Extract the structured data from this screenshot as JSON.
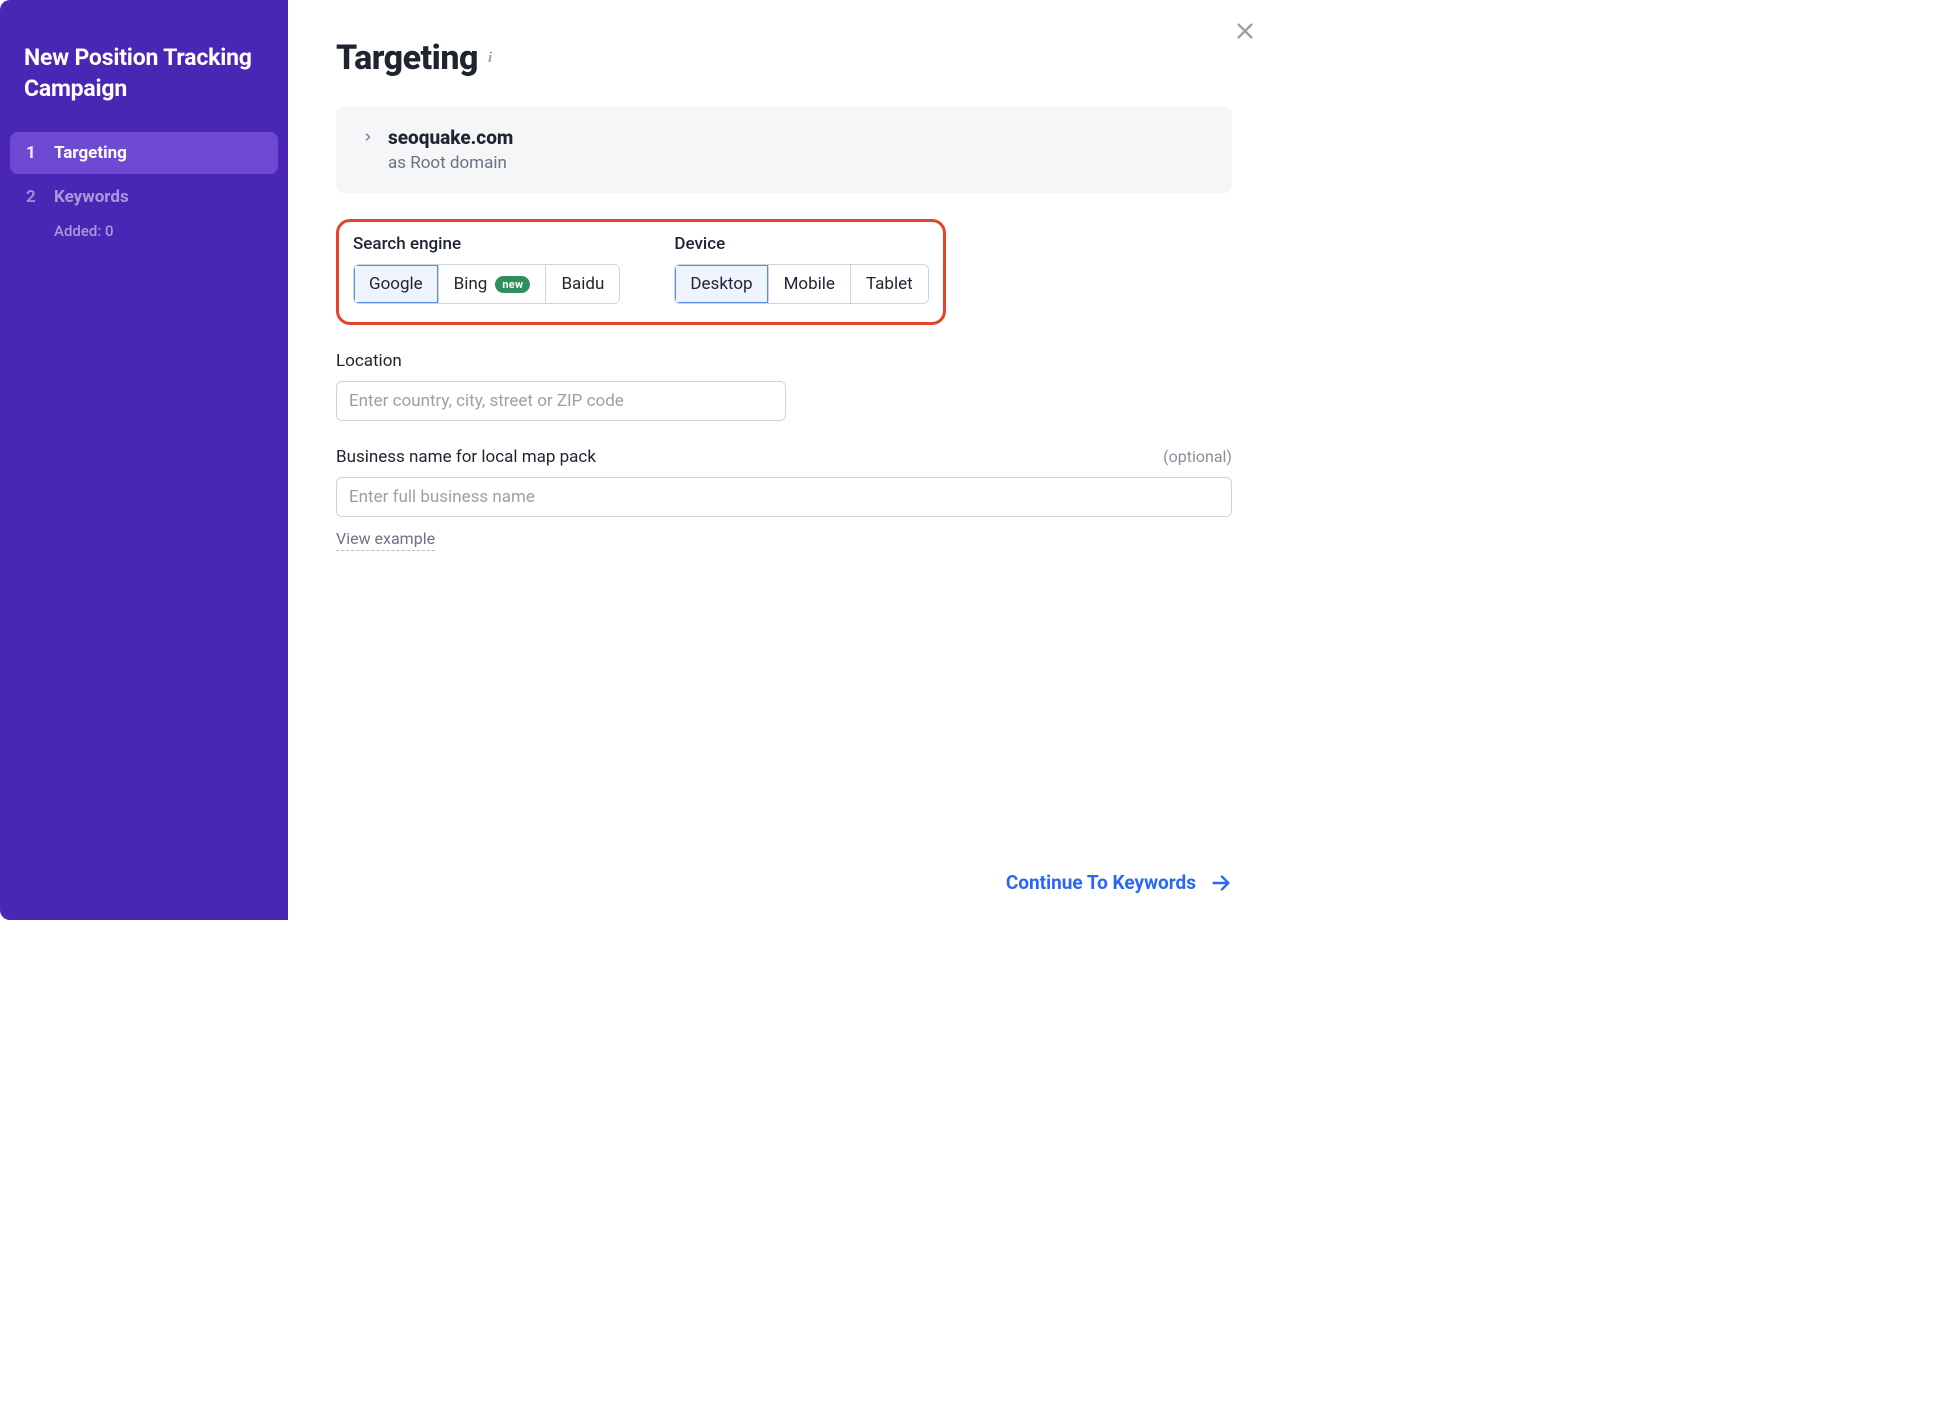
{
  "sidebar": {
    "title": "New Position Tracking Campaign",
    "items": [
      {
        "num": "1",
        "label": "Targeting",
        "active": true
      },
      {
        "num": "2",
        "label": "Keywords",
        "active": false
      }
    ],
    "added_label": "Added: 0"
  },
  "page": {
    "title": "Targeting",
    "info_glyph": "i"
  },
  "domain_card": {
    "domain": "seoquake.com",
    "subtype": "as Root domain"
  },
  "search_engine": {
    "label": "Search engine",
    "options": [
      {
        "label": "Google",
        "selected": true,
        "badge": null
      },
      {
        "label": "Bing",
        "selected": false,
        "badge": "new"
      },
      {
        "label": "Baidu",
        "selected": false,
        "badge": null
      }
    ]
  },
  "device": {
    "label": "Device",
    "options": [
      {
        "label": "Desktop",
        "selected": true
      },
      {
        "label": "Mobile",
        "selected": false
      },
      {
        "label": "Tablet",
        "selected": false
      }
    ]
  },
  "location": {
    "label": "Location",
    "placeholder": "Enter country, city, street or ZIP code"
  },
  "business": {
    "label": "Business name for local map pack",
    "optional": "(optional)",
    "placeholder": "Enter full business name",
    "view_example": "View example"
  },
  "footer": {
    "cta": "Continue To Keywords"
  }
}
